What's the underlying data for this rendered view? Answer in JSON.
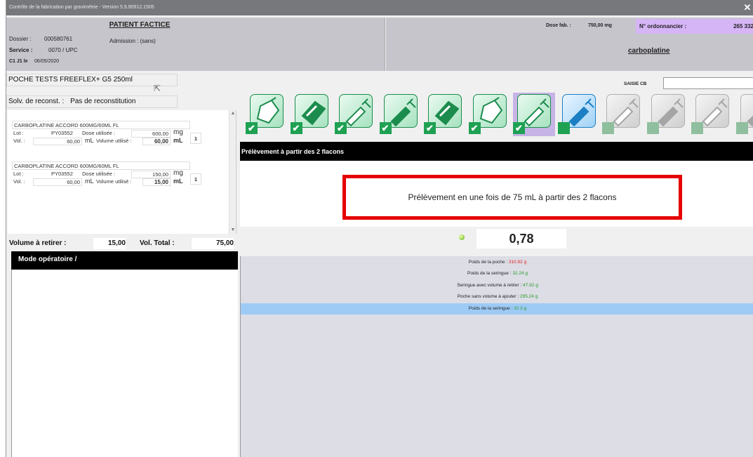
{
  "window": {
    "title": "Contrôle de la fabrication par gravimétrie - Version 5.9.90912.1505",
    "close_icon": "✕"
  },
  "patient": {
    "name": "PATIENT FACTICE",
    "dossier_label": "Dossier :",
    "dossier_value": "000580761",
    "admission": "Admission : (sans)",
    "service_label": "Service :",
    "service_value": "0070 / UPC",
    "cycle_label": "C1 J1 le",
    "cycle_date": "06/05/2020"
  },
  "prescription": {
    "dose_label": "Dose fab. :",
    "dose_value": "750,00 mg",
    "ordonnancier_label": "N° ordonnancier :",
    "ordonnancier_value": "265 332",
    "drug": "carboplatine"
  },
  "poche": "POCHE TESTS FREEFLEX+ G5 250ml",
  "solvant": {
    "label": "Solv. de reconst. :",
    "value": "Pas de reconstitution"
  },
  "saisie_cb": {
    "label": "SAISIE CB",
    "value": ""
  },
  "flacons": [
    {
      "name": "CARBOPLATINE ACCORD 600MG/60ML FL",
      "lot_label": "Lot :",
      "lot": "PY03552",
      "dose_label": "Dose utilisée :",
      "dose": "600,00",
      "dose_unit": "mg",
      "count": "1",
      "vol_label": "Vol. :",
      "vol": "60,00",
      "vol_unit": "mL",
      "vol_used_label": "Volume utilisé :",
      "vol_used": "60,00",
      "vol_used_unit": "mL"
    },
    {
      "name": "CARBOPLATINE ACCORD 600MG/60ML FL",
      "lot_label": "Lot :",
      "lot": "PY03552",
      "dose_label": "Dose utilisée :",
      "dose": "150,00",
      "dose_unit": "mg",
      "count": "1",
      "vol_label": "Vol. :",
      "vol": "60,00",
      "vol_unit": "mL",
      "vol_used_label": "Volume utilisé :",
      "vol_used": "15,00",
      "vol_used_unit": "mL"
    }
  ],
  "totals": {
    "vol_retirer_label": "Volume à retirer :",
    "vol_retirer": "15,00",
    "vol_total_label": "Vol. Total :",
    "vol_total": "75,00"
  },
  "mode_operatoire": "Mode opératoire /",
  "steps": [
    {
      "icon": "bag-weigh-icon",
      "state": "done",
      "tone": "green"
    },
    {
      "icon": "bag-label-icon",
      "state": "done",
      "tone": "green"
    },
    {
      "icon": "syringe-icon",
      "state": "done",
      "tone": "green"
    },
    {
      "icon": "syringe-fill-icon",
      "state": "done",
      "tone": "green"
    },
    {
      "icon": "bag-label-icon",
      "state": "done",
      "tone": "green"
    },
    {
      "icon": "bag-weigh-icon",
      "state": "done",
      "tone": "green"
    },
    {
      "icon": "syringe-icon",
      "state": "done",
      "tone": "green",
      "active": true
    },
    {
      "icon": "syringe-fill-icon",
      "state": "pending",
      "tone": "blue"
    },
    {
      "icon": "syringe-icon",
      "state": "pending",
      "tone": "grey"
    },
    {
      "icon": "syringe-fill-icon",
      "state": "pending",
      "tone": "grey"
    },
    {
      "icon": "syringe-icon",
      "state": "pending",
      "tone": "grey"
    },
    {
      "icon": "syringe-fill-icon",
      "state": "pending",
      "tone": "grey"
    }
  ],
  "step_title": "Prélèvement à partir des 2 flacons",
  "instruction": "Prélèvement en une fois de 75 mL  à partir des 2 flacons",
  "balance": {
    "value": "0,78",
    "status_color": "#5fb30d"
  },
  "log": [
    {
      "label": "Poids de la poche : ",
      "value": "310.92 g",
      "color": "red"
    },
    {
      "label": "Poids de la seringue : ",
      "value": "32.24 g",
      "color": "green"
    },
    {
      "label": "Seringue avec volume à retirer : ",
      "value": "47.92 g",
      "color": "green"
    },
    {
      "label": "Poche sans volume à ajouter : ",
      "value": "295.24 g",
      "color": "green"
    },
    {
      "label": "Poids de la seringue : ",
      "value": "32.3 g",
      "color": "green",
      "selected": true
    }
  ],
  "colors": {
    "accent_green": "#1ea153",
    "alert_red": "#e60000",
    "ordonnancier_bg": "#d6b5f7",
    "selected_row": "#9ecbf6"
  }
}
